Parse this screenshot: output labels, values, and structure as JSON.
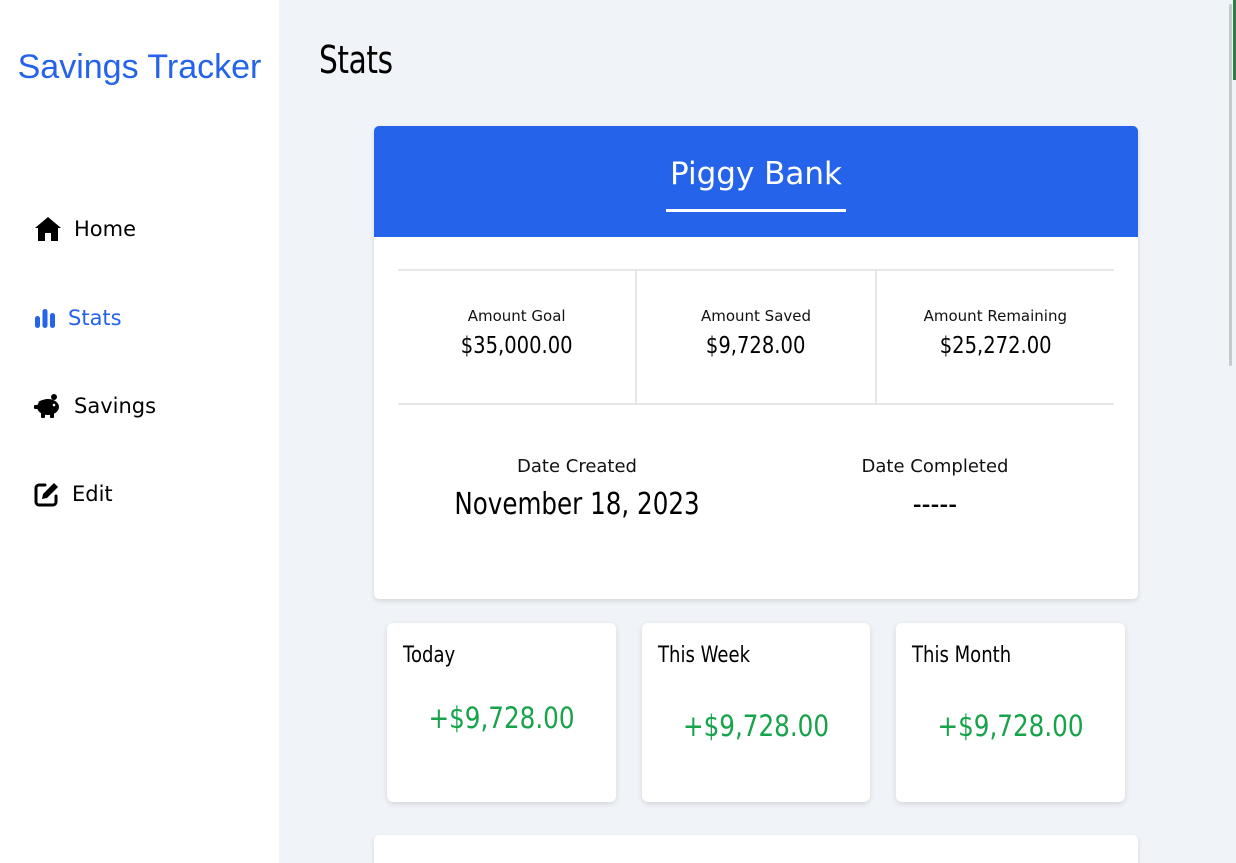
{
  "app": {
    "title": "Savings Tracker"
  },
  "nav": {
    "items": [
      {
        "label": "Home",
        "icon": "home-icon"
      },
      {
        "label": "Stats",
        "icon": "bar-chart-icon",
        "active": true
      },
      {
        "label": "Savings",
        "icon": "piggy-bank-icon"
      },
      {
        "label": "Edit",
        "icon": "edit-icon"
      }
    ]
  },
  "page": {
    "title": "Stats"
  },
  "goal": {
    "name": "Piggy Bank",
    "amounts": [
      {
        "label": "Amount Goal",
        "value": "$35,000.00"
      },
      {
        "label": "Amount Saved",
        "value": "$9,728.00"
      },
      {
        "label": "Amount Remaining",
        "value": "$25,272.00"
      }
    ],
    "dates": [
      {
        "label": "Date Created",
        "value": "November 18, 2023"
      },
      {
        "label": "Date Completed",
        "value": "-----"
      }
    ]
  },
  "periods": [
    {
      "title": "Today",
      "value": "+$9,728.00"
    },
    {
      "title": "This Week",
      "value": "+$9,728.00"
    },
    {
      "title": "This Month",
      "value": "+$9,728.00"
    }
  ],
  "colors": {
    "accent": "#2563eb",
    "positive": "#16a34a",
    "background": "#f0f3f7"
  }
}
